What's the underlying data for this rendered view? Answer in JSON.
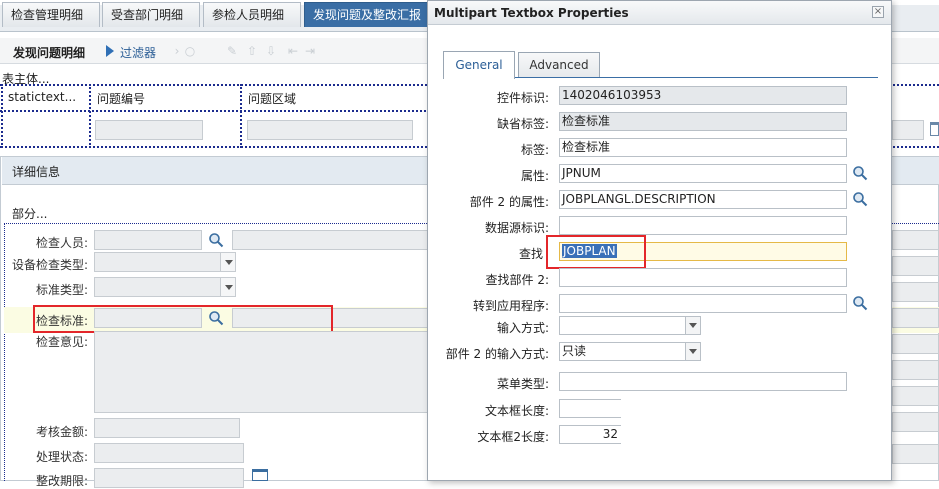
{
  "app": {
    "tabs": [
      {
        "label": "检查管理明细"
      },
      {
        "label": "受查部门明细"
      },
      {
        "label": "参检人员明细"
      },
      {
        "label": "发现问题及整改汇报"
      }
    ],
    "toolbar": {
      "title": "发现问题明细",
      "filter_label": "过滤器"
    },
    "table_section_label": "表主体...",
    "columns": [
      "statictext...",
      "问题编号",
      "问题区域"
    ],
    "detail": {
      "title": "详细信息",
      "part_label": "部分...",
      "fields": {
        "inspector": "检查人员:",
        "equipment_type": "设备检查类型:",
        "standard_type": "标准类型:",
        "check_standard": "检查标准:",
        "check_opinion": "检查意见:",
        "assessment_amount": "考核金额:",
        "process_status": "处理状态:",
        "rectify_deadline": "整改期限:"
      }
    }
  },
  "dialog": {
    "title": "Multipart Textbox Properties",
    "tabs": {
      "general": "General",
      "advanced": "Advanced"
    },
    "props": {
      "control_id": {
        "label": "控件标识:",
        "value": "1402046103953"
      },
      "default_label": {
        "label": "缺省标签:",
        "value": "检查标准"
      },
      "label": {
        "label": "标签:",
        "value": "检查标准"
      },
      "attribute": {
        "label": "属性:",
        "value": "JPNUM"
      },
      "part2_attribute": {
        "label": "部件 2 的属性:",
        "value": "JOBPLANGL.DESCRIPTION"
      },
      "datasource_id": {
        "label": "数据源标识:",
        "value": ""
      },
      "lookup": {
        "label": "查找",
        "value": "JOBPLAN"
      },
      "lookup_part2": {
        "label": "查找部件 2:",
        "value": ""
      },
      "goto_app": {
        "label": "转到应用程序:",
        "value": ""
      },
      "input_mode": {
        "label": "输入方式:",
        "value": ""
      },
      "part2_input_mode": {
        "label": "部件 2 的输入方式:",
        "value": "只读"
      },
      "menu_type": {
        "label": "菜单类型:",
        "value": ""
      },
      "textbox_length": {
        "label": "文本框长度:",
        "value": ""
      },
      "textbox2_length": {
        "label": "文本框2长度:",
        "value": "32"
      }
    }
  },
  "colors": {
    "highlight": "#e3262a",
    "accent": "#3a6ea5"
  }
}
